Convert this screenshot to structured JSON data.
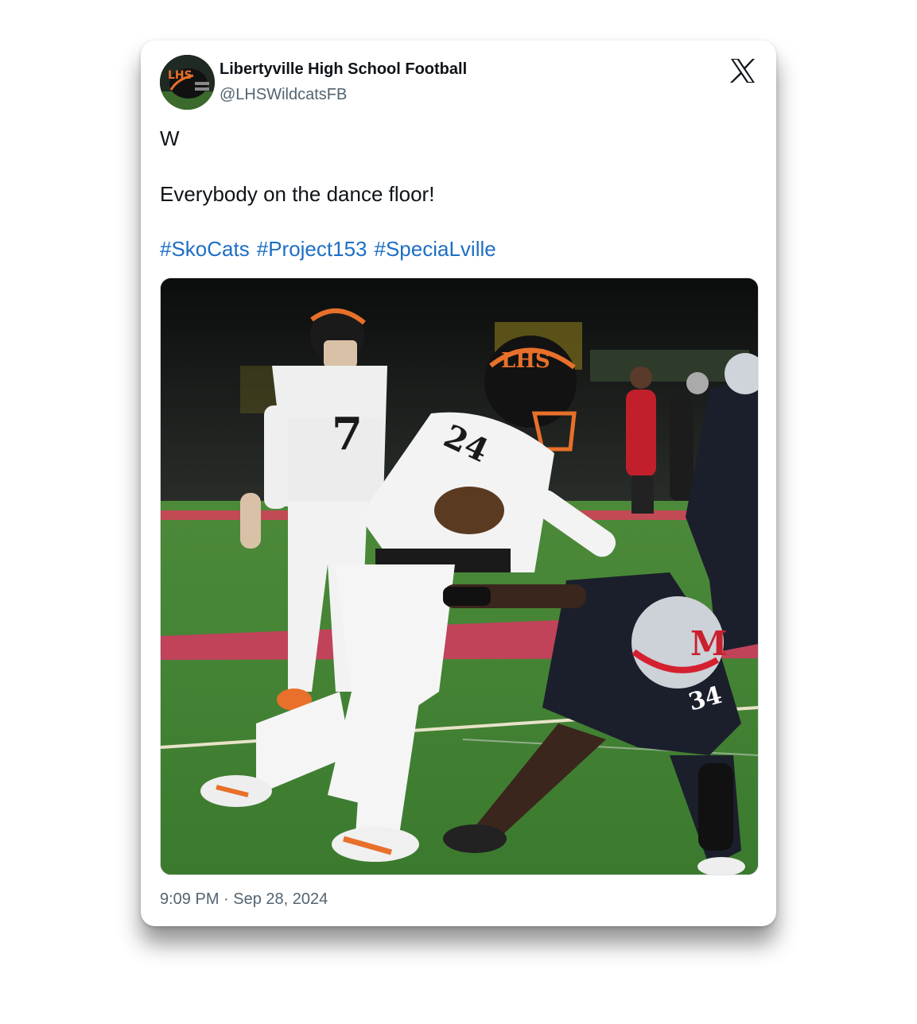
{
  "tweet": {
    "author": {
      "name": "Libertyville High School Football",
      "handle": "@LHSWildcatsFB",
      "avatar_text": "LHS"
    },
    "text_lines": [
      "W",
      "Everybody on the dance floor!"
    ],
    "hashtags": [
      "#SkoCats",
      "#Project153",
      "#SpeciaLville"
    ],
    "media": {
      "jersey_numbers": [
        "7",
        "24",
        "34"
      ],
      "helmet_text": "LHS",
      "opponent_letter": "M"
    },
    "time": "9:09 PM",
    "separator": "·",
    "date": "Sep 28, 2024"
  },
  "icons": {
    "platform_logo": "x-logo-icon"
  },
  "colors": {
    "hashtag": "#1d6ec6",
    "name": "#0f1419",
    "secondary": "#536471"
  }
}
